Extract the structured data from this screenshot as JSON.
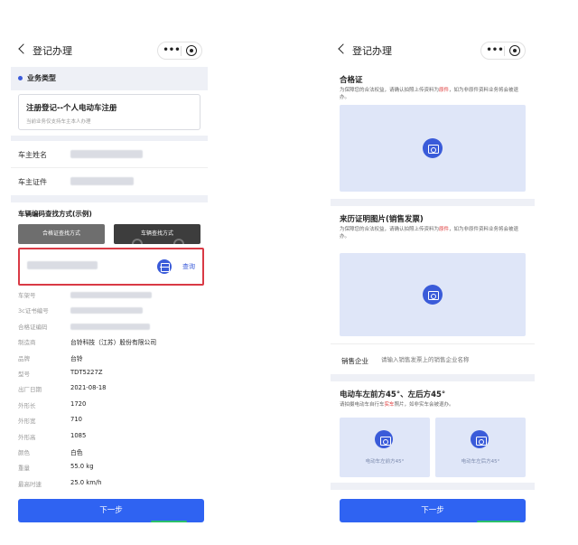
{
  "left": {
    "nav_title": "登记办理",
    "capsule_dots": "•••",
    "section_title": "业务类型",
    "reg_card": {
      "title": "注册登记--个人电动车注册",
      "subtitle": "当前业务仅支持车主本人办理"
    },
    "owner_name_label": "车主姓名",
    "owner_id_label": "车主证件",
    "example_title": "车辆编码查找方式(示例)",
    "example_buttons": [
      "合格证查找方式",
      "车辆查找方式"
    ],
    "query_label": "查询",
    "info_rows": [
      {
        "label": "车架号",
        "value": ""
      },
      {
        "label": "3c证书编号",
        "value": ""
      },
      {
        "label": "合格证编码",
        "value": ""
      },
      {
        "label": "制造商",
        "value": "台铃科技（江苏）股份有限公司"
      },
      {
        "label": "品牌",
        "value": "台铃"
      },
      {
        "label": "型号",
        "value": "TDT5227Z"
      },
      {
        "label": "出厂日期",
        "value": "2021-08-18"
      },
      {
        "label": "外形长",
        "value": "1720"
      },
      {
        "label": "外形宽",
        "value": "710"
      },
      {
        "label": "外形高",
        "value": "1085"
      },
      {
        "label": "颜色",
        "value": "白色"
      },
      {
        "label": "重量",
        "value": "55.0 kg"
      },
      {
        "label": "最高时速",
        "value": "25.0 km/h"
      }
    ],
    "next_button": "下一步"
  },
  "right": {
    "nav_title": "登记办理",
    "capsule_dots": "•••",
    "certificate": {
      "title": "合格证",
      "note_pre": "为保障您的合法权益，请确认拍照上传资料为",
      "note_red": "原件",
      "note_post": "，如为非原件资料业务将会被退办。"
    },
    "proof": {
      "title": "来历证明图片(销售发票)",
      "note_pre": "为保障您的合法权益，请确认拍照上传资料为",
      "note_red": "原件",
      "note_post": "，如为非原件资料业务将会被退办。"
    },
    "seller_label": "销售企业",
    "seller_placeholder": "请输入销售发票上的销售企业名称",
    "photo_section": {
      "title": "电动车左前方45°、左后方45°",
      "note_pre": "请拍摄电动车自行车",
      "note_red": "实车",
      "note_post": "照片，如非实车会被退办。",
      "tiles": [
        "电动车左前方45°",
        "电动车左后方45°"
      ]
    },
    "next_button": "下一步"
  },
  "colors": {
    "primary": "#2f63f2",
    "highlight": "#d93a45",
    "upload_bg": "#dfe6f8"
  }
}
